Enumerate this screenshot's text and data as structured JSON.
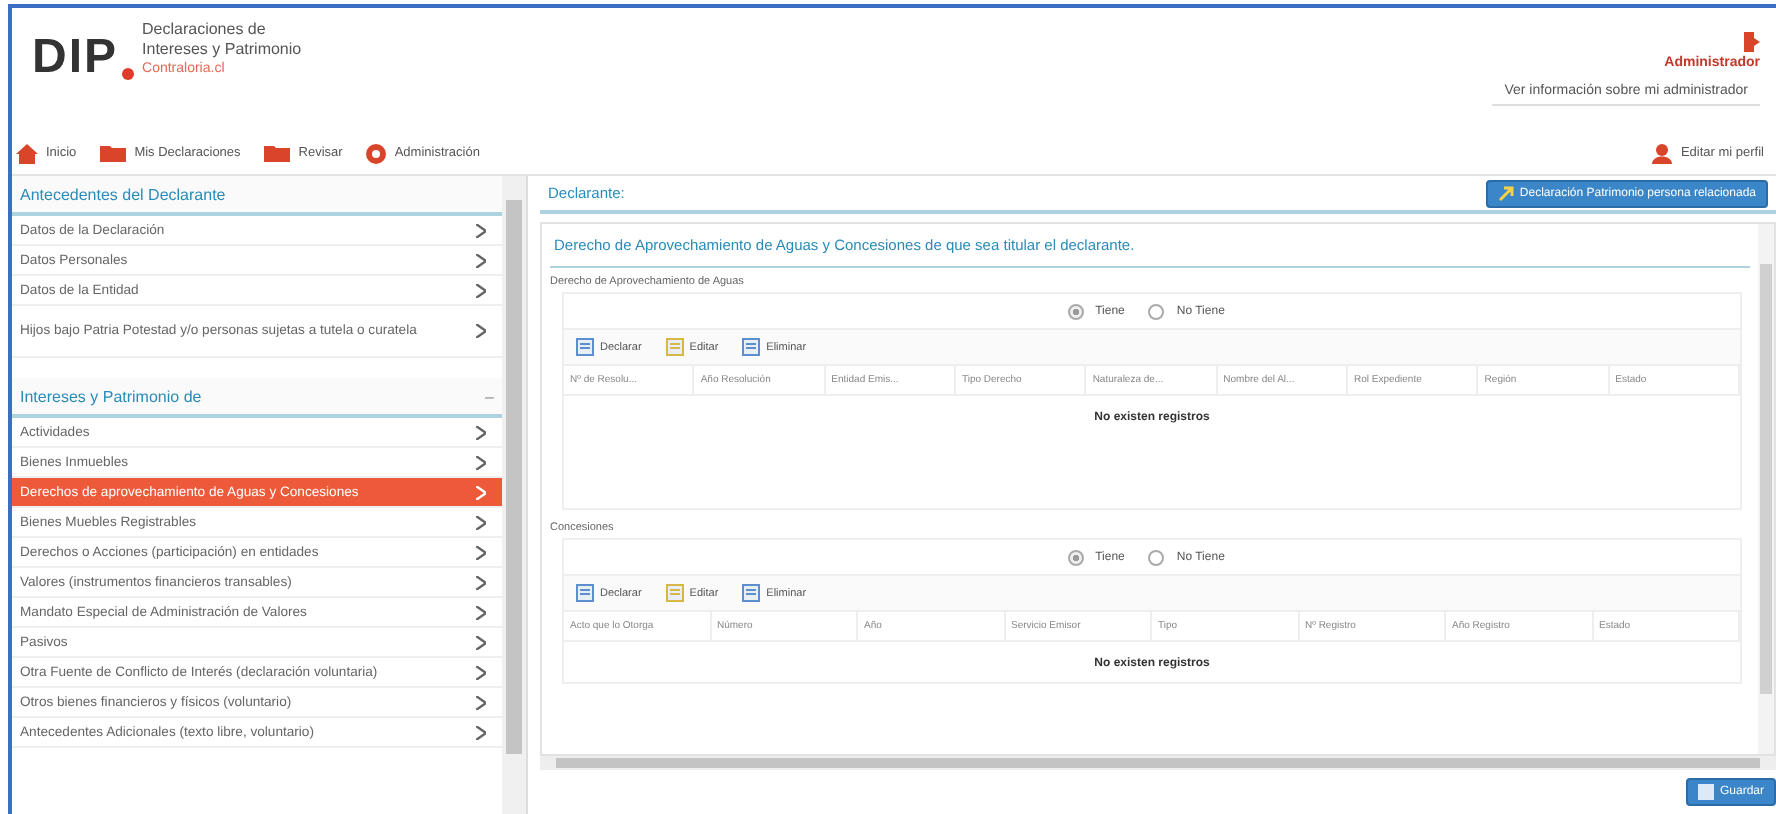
{
  "header": {
    "logo": "DIP",
    "title_line1": "Declaraciones de",
    "title_line2": "Intereses y Patrimonio",
    "site": "Contraloria.cl",
    "user": "Administrador",
    "user_info": "Ver información sobre mi administrador"
  },
  "nav": [
    {
      "label": "Inicio",
      "kind": "home"
    },
    {
      "label": "Mis Declaraciones",
      "kind": "folder"
    },
    {
      "label": "Revisar",
      "kind": "folder"
    },
    {
      "label": "Administración",
      "kind": "settings"
    }
  ],
  "profile_link": "Editar mi perfil",
  "sidebar": {
    "sections": [
      {
        "title": "Antecedentes del Declarante",
        "items": [
          {
            "label": "Datos de la Declaración",
            "selected": false
          },
          {
            "label": "Datos Personales",
            "selected": false
          },
          {
            "label": "Datos de la Entidad",
            "selected": false
          },
          {
            "label": "Hijos bajo Patria Potestad y/o personas sujetas a tutela o curatela",
            "selected": false
          }
        ]
      },
      {
        "title": "Intereses y Patrimonio de",
        "collapse": "–",
        "items": [
          {
            "label": "Actividades",
            "selected": false
          },
          {
            "label": "Bienes Inmuebles",
            "selected": false
          },
          {
            "label": "Derechos de aprovechamiento de Aguas y Concesiones",
            "selected": true
          },
          {
            "label": "Bienes Muebles Registrables",
            "selected": false
          },
          {
            "label": "Derechos o Acciones (participación) en entidades",
            "selected": false
          },
          {
            "label": "Valores (instrumentos financieros transables)",
            "selected": false
          },
          {
            "label": "Mandato Especial de Administración de Valores",
            "selected": false
          },
          {
            "label": "Pasivos",
            "selected": false
          },
          {
            "label": "Otra Fuente de Conflicto de Interés (declaración voluntaria)",
            "selected": false
          },
          {
            "label": "Otros bienes financieros y físicos (voluntario)",
            "selected": false
          },
          {
            "label": "Antecedentes Adicionales (texto libre, voluntario)",
            "selected": false
          }
        ]
      }
    ]
  },
  "main": {
    "declarant_label": "Declarante:",
    "top_button": "Declaración Patrimonio persona relacionada",
    "title": "Derecho de Aprovechamiento de Aguas y Concesiones de que sea titular el declarante.",
    "groups": [
      {
        "legend": "Derecho de Aprovechamiento de Aguas",
        "options": [
          {
            "label": "Tiene",
            "selected": true
          },
          {
            "label": "No Tiene",
            "selected": false
          }
        ],
        "tools": [
          "Declarar",
          "Editar",
          "Eliminar"
        ],
        "columns": [
          "Nº de Resolu...",
          "Año Resolución",
          "Entidad Emis...",
          "Tipo Derecho",
          "Naturaleza de...",
          "Nombre del Al...",
          "Rol Expediente",
          "Región",
          "Estado"
        ],
        "empty": "No existen registros"
      },
      {
        "legend": "Concesiones",
        "options": [
          {
            "label": "Tiene",
            "selected": true
          },
          {
            "label": "No Tiene",
            "selected": false
          }
        ],
        "tools": [
          "Declarar",
          "Editar",
          "Eliminar"
        ],
        "columns": [
          "Acto que lo Otorga",
          "Número",
          "Año",
          "Servicio Emisor",
          "Tipo",
          "Nº Registro",
          "Año Registro",
          "Estado"
        ],
        "empty": "No existen registros"
      }
    ],
    "bottom_button": "Guardar"
  }
}
